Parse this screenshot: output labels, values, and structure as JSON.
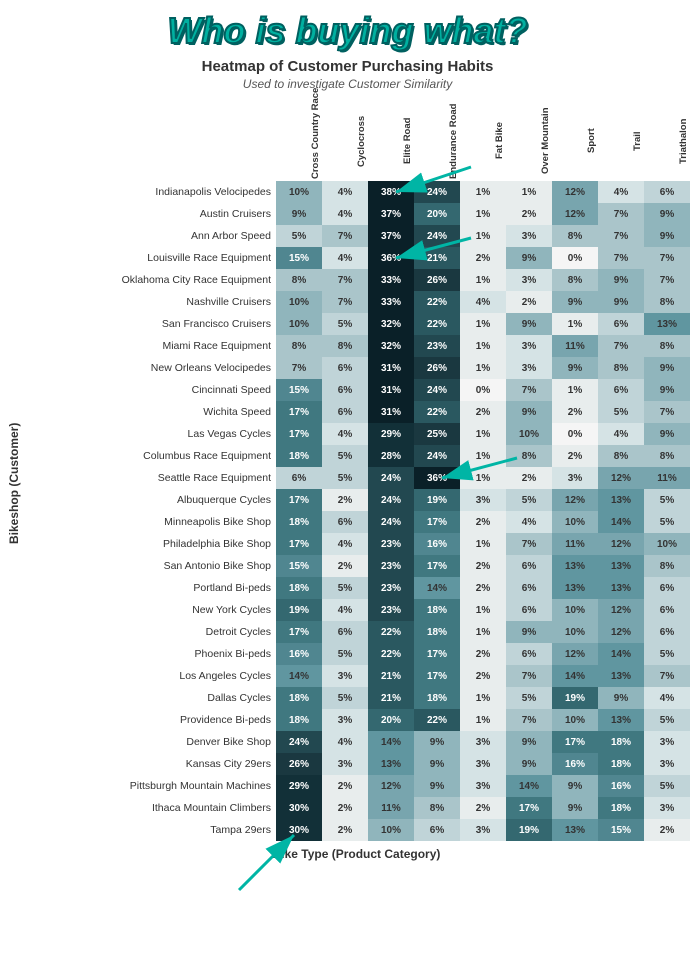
{
  "title": "Who is buying what?",
  "subtitle": "Heatmap of Customer Purchasing Habits",
  "subtitle2": "Used to investigate Customer Similarity",
  "xAxisLabel": "Bike Type (Product Category)",
  "yAxisLabel": "Bikeshop (Customer)",
  "columns": [
    "Cross Country Race",
    "Cyclocross",
    "Elite Road",
    "Endurance Road",
    "Fat Bike",
    "Over Mountain",
    "Sport",
    "Trail",
    "Triathalon"
  ],
  "rows": [
    {
      "label": "Indianapolis Velocipedes",
      "values": [
        10,
        4,
        38,
        24,
        1,
        1,
        12,
        4,
        6
      ]
    },
    {
      "label": "Austin Cruisers",
      "values": [
        9,
        4,
        37,
        20,
        1,
        2,
        12,
        7,
        9
      ]
    },
    {
      "label": "Ann Arbor Speed",
      "values": [
        5,
        7,
        37,
        24,
        1,
        3,
        8,
        7,
        9
      ]
    },
    {
      "label": "Louisville Race Equipment",
      "values": [
        15,
        4,
        36,
        21,
        2,
        9,
        0,
        7,
        7
      ]
    },
    {
      "label": "Oklahoma City Race Equipment",
      "values": [
        8,
        7,
        33,
        26,
        1,
        3,
        8,
        9,
        7
      ]
    },
    {
      "label": "Nashville Cruisers",
      "values": [
        10,
        7,
        33,
        22,
        4,
        2,
        9,
        9,
        8
      ]
    },
    {
      "label": "San Francisco Cruisers",
      "values": [
        10,
        5,
        32,
        22,
        1,
        9,
        1,
        6,
        13
      ]
    },
    {
      "label": "Miami Race Equipment",
      "values": [
        8,
        8,
        32,
        23,
        1,
        3,
        11,
        7,
        8
      ]
    },
    {
      "label": "New Orleans Velocipedes",
      "values": [
        7,
        6,
        31,
        26,
        1,
        3,
        9,
        8,
        9
      ]
    },
    {
      "label": "Cincinnati Speed",
      "values": [
        15,
        6,
        31,
        24,
        0,
        7,
        1,
        6,
        9
      ]
    },
    {
      "label": "Wichita Speed",
      "values": [
        17,
        6,
        31,
        22,
        2,
        9,
        2,
        5,
        7
      ]
    },
    {
      "label": "Las Vegas Cycles",
      "values": [
        17,
        4,
        29,
        25,
        1,
        10,
        0,
        4,
        9
      ]
    },
    {
      "label": "Columbus Race Equipment",
      "values": [
        18,
        5,
        28,
        24,
        1,
        8,
        2,
        8,
        8
      ]
    },
    {
      "label": "Seattle Race Equipment",
      "values": [
        6,
        5,
        24,
        36,
        1,
        2,
        3,
        12,
        11
      ]
    },
    {
      "label": "Albuquerque Cycles",
      "values": [
        17,
        2,
        24,
        19,
        3,
        5,
        12,
        13,
        5
      ]
    },
    {
      "label": "Minneapolis Bike Shop",
      "values": [
        18,
        6,
        24,
        17,
        2,
        4,
        10,
        14,
        5
      ]
    },
    {
      "label": "Philadelphia Bike Shop",
      "values": [
        17,
        4,
        23,
        16,
        1,
        7,
        11,
        12,
        10
      ]
    },
    {
      "label": "San Antonio Bike Shop",
      "values": [
        15,
        2,
        23,
        17,
        2,
        6,
        13,
        13,
        8
      ]
    },
    {
      "label": "Portland Bi-peds",
      "values": [
        18,
        5,
        23,
        14,
        2,
        6,
        13,
        13,
        6
      ]
    },
    {
      "label": "New York Cycles",
      "values": [
        19,
        4,
        23,
        18,
        1,
        6,
        10,
        12,
        6
      ]
    },
    {
      "label": "Detroit Cycles",
      "values": [
        17,
        6,
        22,
        18,
        1,
        9,
        10,
        12,
        6
      ]
    },
    {
      "label": "Phoenix Bi-peds",
      "values": [
        16,
        5,
        22,
        17,
        2,
        6,
        12,
        14,
        5
      ]
    },
    {
      "label": "Los Angeles Cycles",
      "values": [
        14,
        3,
        21,
        17,
        2,
        7,
        14,
        13,
        7
      ]
    },
    {
      "label": "Dallas Cycles",
      "values": [
        18,
        5,
        21,
        18,
        1,
        5,
        19,
        9,
        4
      ]
    },
    {
      "label": "Providence Bi-peds",
      "values": [
        18,
        3,
        20,
        22,
        1,
        7,
        10,
        13,
        5
      ]
    },
    {
      "label": "Denver Bike Shop",
      "values": [
        24,
        4,
        14,
        9,
        3,
        9,
        17,
        18,
        3
      ]
    },
    {
      "label": "Kansas City 29ers",
      "values": [
        26,
        3,
        13,
        9,
        3,
        9,
        16,
        18,
        3
      ]
    },
    {
      "label": "Pittsburgh Mountain Machines",
      "values": [
        29,
        2,
        12,
        9,
        3,
        14,
        9,
        16,
        5
      ]
    },
    {
      "label": "Ithaca Mountain Climbers",
      "values": [
        30,
        2,
        11,
        8,
        2,
        17,
        9,
        18,
        3
      ]
    },
    {
      "label": "Tampa 29ers",
      "values": [
        30,
        2,
        10,
        6,
        3,
        19,
        13,
        15,
        2
      ]
    }
  ]
}
